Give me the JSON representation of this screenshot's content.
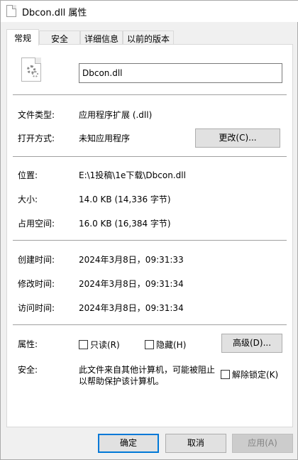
{
  "window": {
    "title": "Dbcon.dll 属性"
  },
  "tabs": [
    "常规",
    "安全",
    "详细信息",
    "以前的版本"
  ],
  "file": {
    "name": "Dbcon.dll"
  },
  "general": {
    "type_label": "文件类型:",
    "type_value": "应用程序扩展 (.dll)",
    "opens_label": "打开方式:",
    "opens_value": "未知应用程序",
    "change_button": "更改(C)...",
    "location_label": "位置:",
    "location_value": "E:\\1投稿\\1e下载\\Dbcon.dll",
    "size_label": "大小:",
    "size_value": "14.0 KB (14,336 字节)",
    "disk_label": "占用空间:",
    "disk_value": "16.0 KB (16,384 字节)",
    "created_label": "创建时间:",
    "created_value": "2024年3月8日，09:31:33",
    "modified_label": "修改时间:",
    "modified_value": "2024年3月8日，09:31:34",
    "accessed_label": "访问时间:",
    "accessed_value": "2024年3月8日，09:31:34",
    "attributes_label": "属性:",
    "readonly_label": "只读(R)",
    "hidden_label": "隐藏(H)",
    "advanced_button": "高级(D)...",
    "security_label": "安全:",
    "security_text_1": "此文件来自其他计算机，可能被阻止",
    "security_text_2": "以帮助保护该计算机。",
    "unblock_label": "解除锁定(K)"
  },
  "footer": {
    "ok": "确定",
    "cancel": "取消",
    "apply": "应用(A)"
  }
}
